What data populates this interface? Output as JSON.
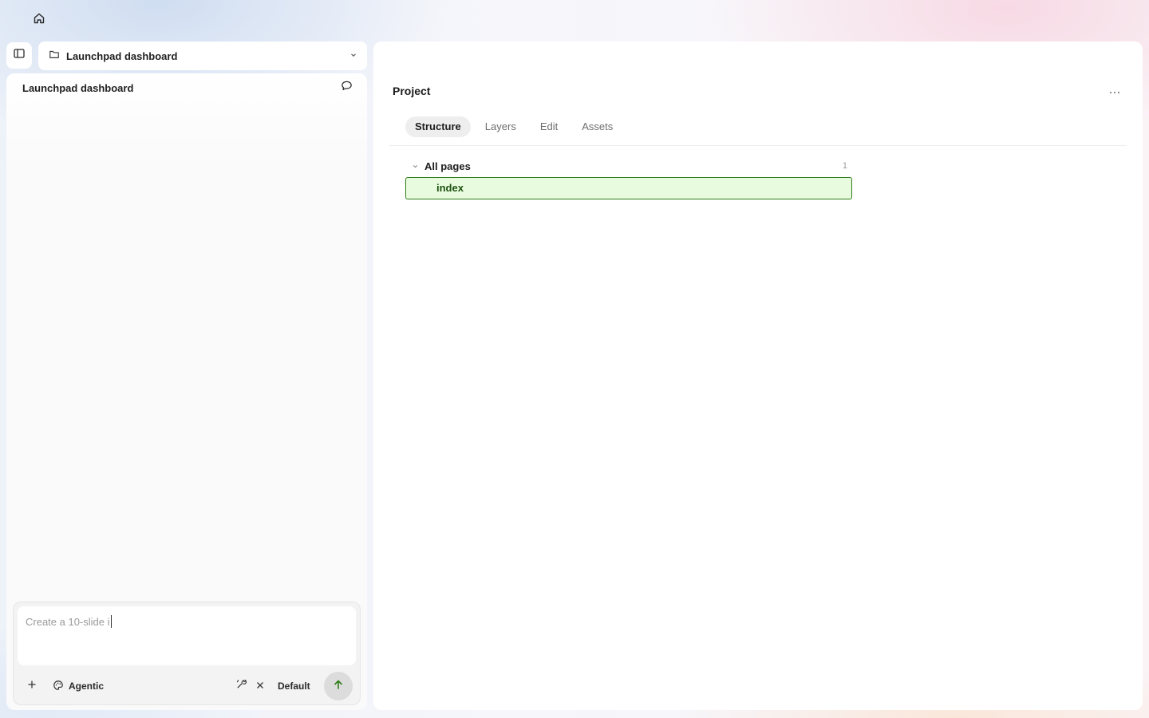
{
  "topbar": {
    "home_icon": "home-icon"
  },
  "project_selector": {
    "toggle_icon": "sidebar-toggle-icon",
    "folder_icon": "folder-icon",
    "label": "Launchpad dashboard",
    "chevron_icon": "chevron-down-icon"
  },
  "chat": {
    "title": "Launchpad dashboard",
    "comment_icon": "message-icon"
  },
  "composer": {
    "input_value": "Create a 10-slide i",
    "plus_icon": "plus-icon",
    "mode_icon": "palette-icon",
    "mode_label": "Agentic",
    "tool_icon": "tool-icon",
    "close_icon": "close-icon",
    "model_label": "Default",
    "send_icon": "arrow-up-icon",
    "send_icon_color": "#2f7d1a"
  },
  "main": {
    "heading": "Project",
    "more_icon": "more-horizontal-icon",
    "tabs": [
      {
        "label": "Structure",
        "active": true
      },
      {
        "label": "Layers",
        "active": false
      },
      {
        "label": "Edit",
        "active": false
      },
      {
        "label": "Assets",
        "active": false
      }
    ],
    "tree": {
      "group_label": "All pages",
      "group_count": "1",
      "items": [
        {
          "label": "index",
          "selected": true
        }
      ]
    },
    "selected_color": "#2f7d1a",
    "selected_bg": "#e9fbdf"
  }
}
